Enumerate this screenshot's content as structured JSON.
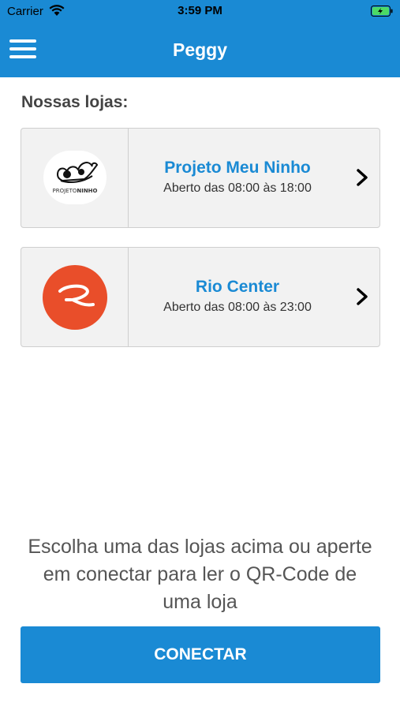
{
  "status_bar": {
    "carrier": "Carrier",
    "time": "3:59 PM",
    "wifi_icon": "wifi-icon",
    "battery_icon": "battery-charging-icon"
  },
  "header": {
    "title": "Peggy",
    "menu_icon": "hamburger-menu-icon",
    "background_color": "#1a8ad4"
  },
  "stores_section": {
    "title": "Nossas lojas:",
    "stores": [
      {
        "name": "Projeto Meu Ninho",
        "hours": "Aberto das 08:00 às 18:00",
        "logo_text_light": "PROJETO",
        "logo_text_bold": "NINHO",
        "logo_icon": "birds-nest-logo"
      },
      {
        "name": "Rio Center",
        "hours": "Aberto das 08:00 às 23:00",
        "logo_icon": "rio-center-logo",
        "logo_color": "#e94e2a"
      }
    ]
  },
  "footer": {
    "helper_text": "Escolha uma das lojas acima ou aperte em conectar para ler o QR-Code de uma loja",
    "connect_label": "CONECTAR"
  }
}
